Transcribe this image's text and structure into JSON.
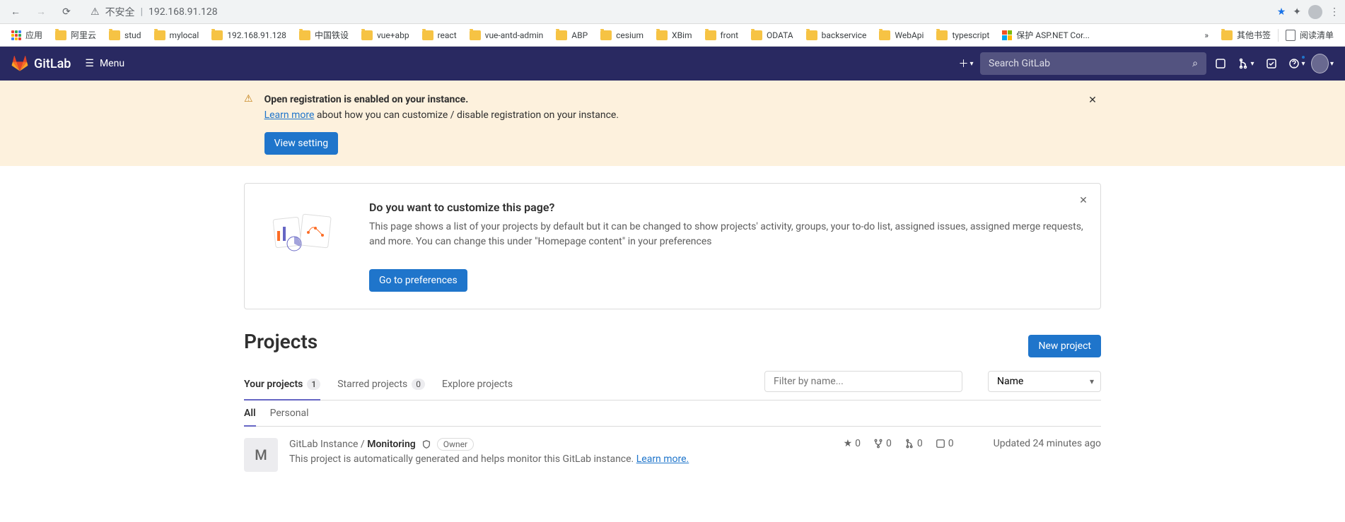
{
  "chrome": {
    "insecure": "不安全",
    "url": "192.168.91.128"
  },
  "bookmarks": {
    "apps": "应用",
    "items": [
      "阿里云",
      "stud",
      "mylocal",
      "192.168.91.128",
      "中国铁设",
      "vue+abp",
      "react",
      "vue-antd-admin",
      "ABP",
      "cesium",
      "XBim",
      "front",
      "ODATA",
      "backservice",
      "WebApi",
      "typescript"
    ],
    "ms_item": "保护 ASP.NET Cor...",
    "more": "»",
    "other": "其他书签",
    "reading": "阅读清单"
  },
  "header": {
    "brand": "GitLab",
    "menu": "Menu",
    "search_placeholder": "Search GitLab"
  },
  "alert": {
    "title": "Open registration is enabled on your instance.",
    "learn": "Learn more",
    "text": " about how you can customize / disable registration on your instance.",
    "button": "View setting"
  },
  "banner": {
    "title": "Do you want to customize this page?",
    "text": "This page shows a list of your projects by default but it can be changed to show projects' activity, groups, your to-do list, assigned issues, assigned merge requests, and more. You can change this under \"Homepage content\" in your preferences",
    "button": "Go to preferences"
  },
  "page": {
    "title": "Projects",
    "new_project": "New project"
  },
  "tabs": {
    "your": "Your projects",
    "your_count": "1",
    "starred": "Starred projects",
    "starred_count": "0",
    "explore": "Explore projects",
    "filter_placeholder": "Filter by name...",
    "sort": "Name",
    "all": "All",
    "personal": "Personal"
  },
  "project": {
    "letter": "M",
    "namespace": "GitLab Instance / ",
    "name": "Monitoring",
    "role": "Owner",
    "desc_pre": "This project is automatically generated and helps monitor this GitLab instance. ",
    "desc_link": "Learn more.",
    "stars": "0",
    "forks": "0",
    "mrs": "0",
    "issues": "0",
    "updated": "Updated 24 minutes ago"
  }
}
